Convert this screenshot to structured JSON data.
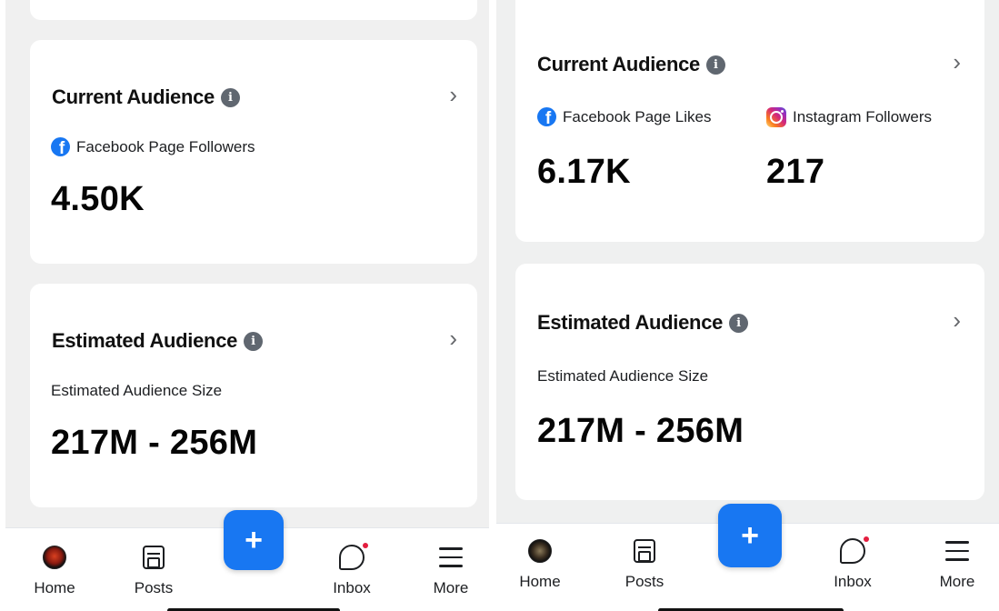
{
  "left": {
    "current_audience": {
      "title": "Current Audience",
      "metrics": [
        {
          "label": "Facebook Page Followers",
          "value": "4.50K",
          "icon": "facebook-icon"
        }
      ]
    },
    "estimated_audience": {
      "title": "Estimated Audience",
      "label": "Estimated Audience Size",
      "value": "217M - 256M"
    }
  },
  "right": {
    "current_audience": {
      "title": "Current Audience",
      "metrics": [
        {
          "label": "Facebook Page Likes",
          "value": "6.17K",
          "icon": "facebook-icon"
        },
        {
          "label": "Instagram Followers",
          "value": "217",
          "icon": "instagram-icon"
        }
      ]
    },
    "estimated_audience": {
      "title": "Estimated Audience",
      "label": "Estimated Audience Size",
      "value": "217M - 256M"
    }
  },
  "tabbar": {
    "tabs": [
      {
        "label": "Home",
        "icon": "avatar-icon"
      },
      {
        "label": "Posts",
        "icon": "posts-icon"
      },
      {
        "label": "Inbox",
        "icon": "chat-bubble-icon"
      },
      {
        "label": "More",
        "icon": "hamburger-menu-icon"
      }
    ],
    "fab_icon": "+",
    "info_glyph": "i",
    "chevron_glyph": "›"
  },
  "colors": {
    "accent": "#1877f2",
    "background": "#f0f0f0",
    "card": "#ffffff",
    "notification_dot": "#e41e3f"
  }
}
